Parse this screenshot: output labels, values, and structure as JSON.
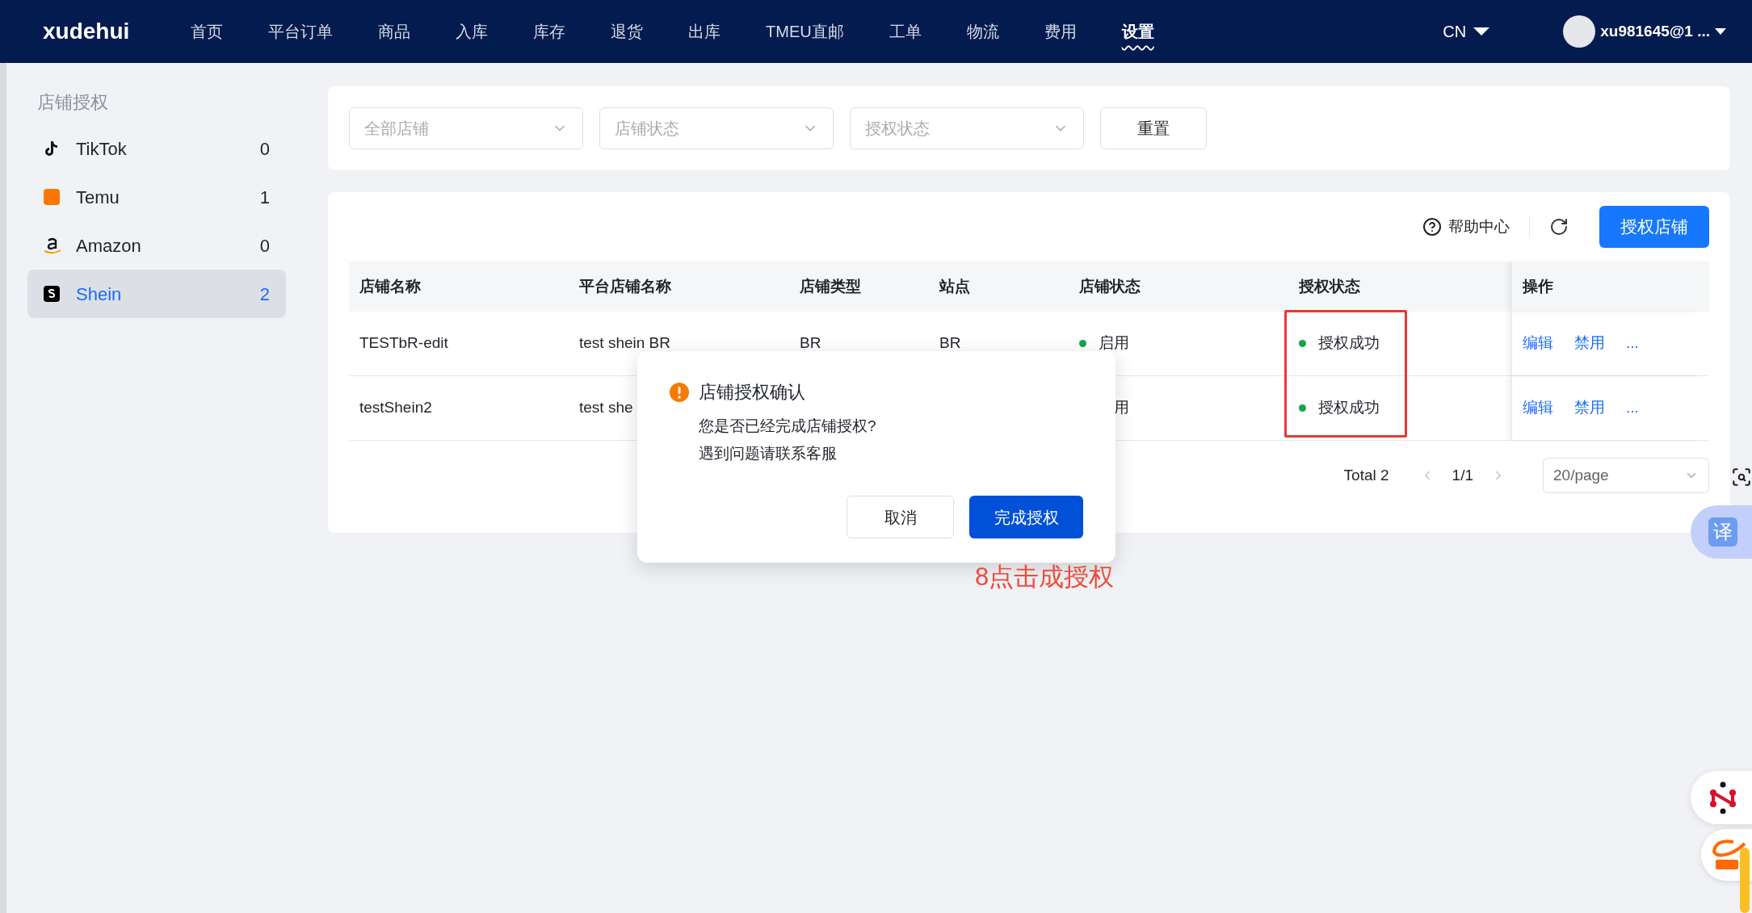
{
  "nav": {
    "logo": "xudehui",
    "items": [
      {
        "label": "首页",
        "selected": false
      },
      {
        "label": "平台订单",
        "selected": false
      },
      {
        "label": "商品",
        "selected": false
      },
      {
        "label": "入库",
        "selected": false
      },
      {
        "label": "库存",
        "selected": false
      },
      {
        "label": "退货",
        "selected": false
      },
      {
        "label": "出库",
        "selected": false
      },
      {
        "label": "TMEU直邮",
        "selected": false
      },
      {
        "label": "工单",
        "selected": false
      },
      {
        "label": "物流",
        "selected": false
      },
      {
        "label": "费用",
        "selected": false
      },
      {
        "label": "设置",
        "selected": true
      }
    ],
    "language": "CN",
    "user": "xu981645@1 ..."
  },
  "sidebar": {
    "title": "店铺授权",
    "items": [
      {
        "name": "TikTok",
        "count": "0",
        "selected": false
      },
      {
        "name": "Temu",
        "count": "1",
        "selected": false
      },
      {
        "name": "Amazon",
        "count": "0",
        "selected": false
      },
      {
        "name": "Shein",
        "count": "2",
        "selected": true
      }
    ]
  },
  "filters": [
    {
      "placeholder": "全部店铺"
    },
    {
      "placeholder": "店铺状态"
    },
    {
      "placeholder": "授权状态"
    }
  ],
  "reset_button": "重置",
  "toolbar": {
    "help": "帮助中心",
    "authorize_button": "授权店铺"
  },
  "table": {
    "columns": [
      "店铺名称",
      "平台店铺名称",
      "店铺类型",
      "站点",
      "店铺状态",
      "授权状态",
      "操作"
    ],
    "rows": [
      {
        "store_name": "TESTbR-edit",
        "platform_name": "test shein BR",
        "store_type": "BR",
        "site": "BR",
        "store_status": "启用",
        "auth_status": "授权成功",
        "actions": [
          "编辑",
          "禁用",
          "..."
        ]
      },
      {
        "store_name": "testShein2",
        "platform_name": "test she",
        "store_status_tail": "用",
        "auth_status": "授权成功",
        "actions": [
          "编辑",
          "禁用",
          "..."
        ]
      }
    ]
  },
  "pagination": {
    "total": "Total 2",
    "page": "1/1",
    "page_size": "20/page"
  },
  "dialog": {
    "title": "店铺授权确认",
    "lines": [
      "您是否已经完成店铺授权?",
      "遇到问题请联系客服"
    ],
    "cancel": "取消",
    "confirm": "完成授权"
  },
  "annotation": "8点击成授权",
  "translate_button": "译"
}
